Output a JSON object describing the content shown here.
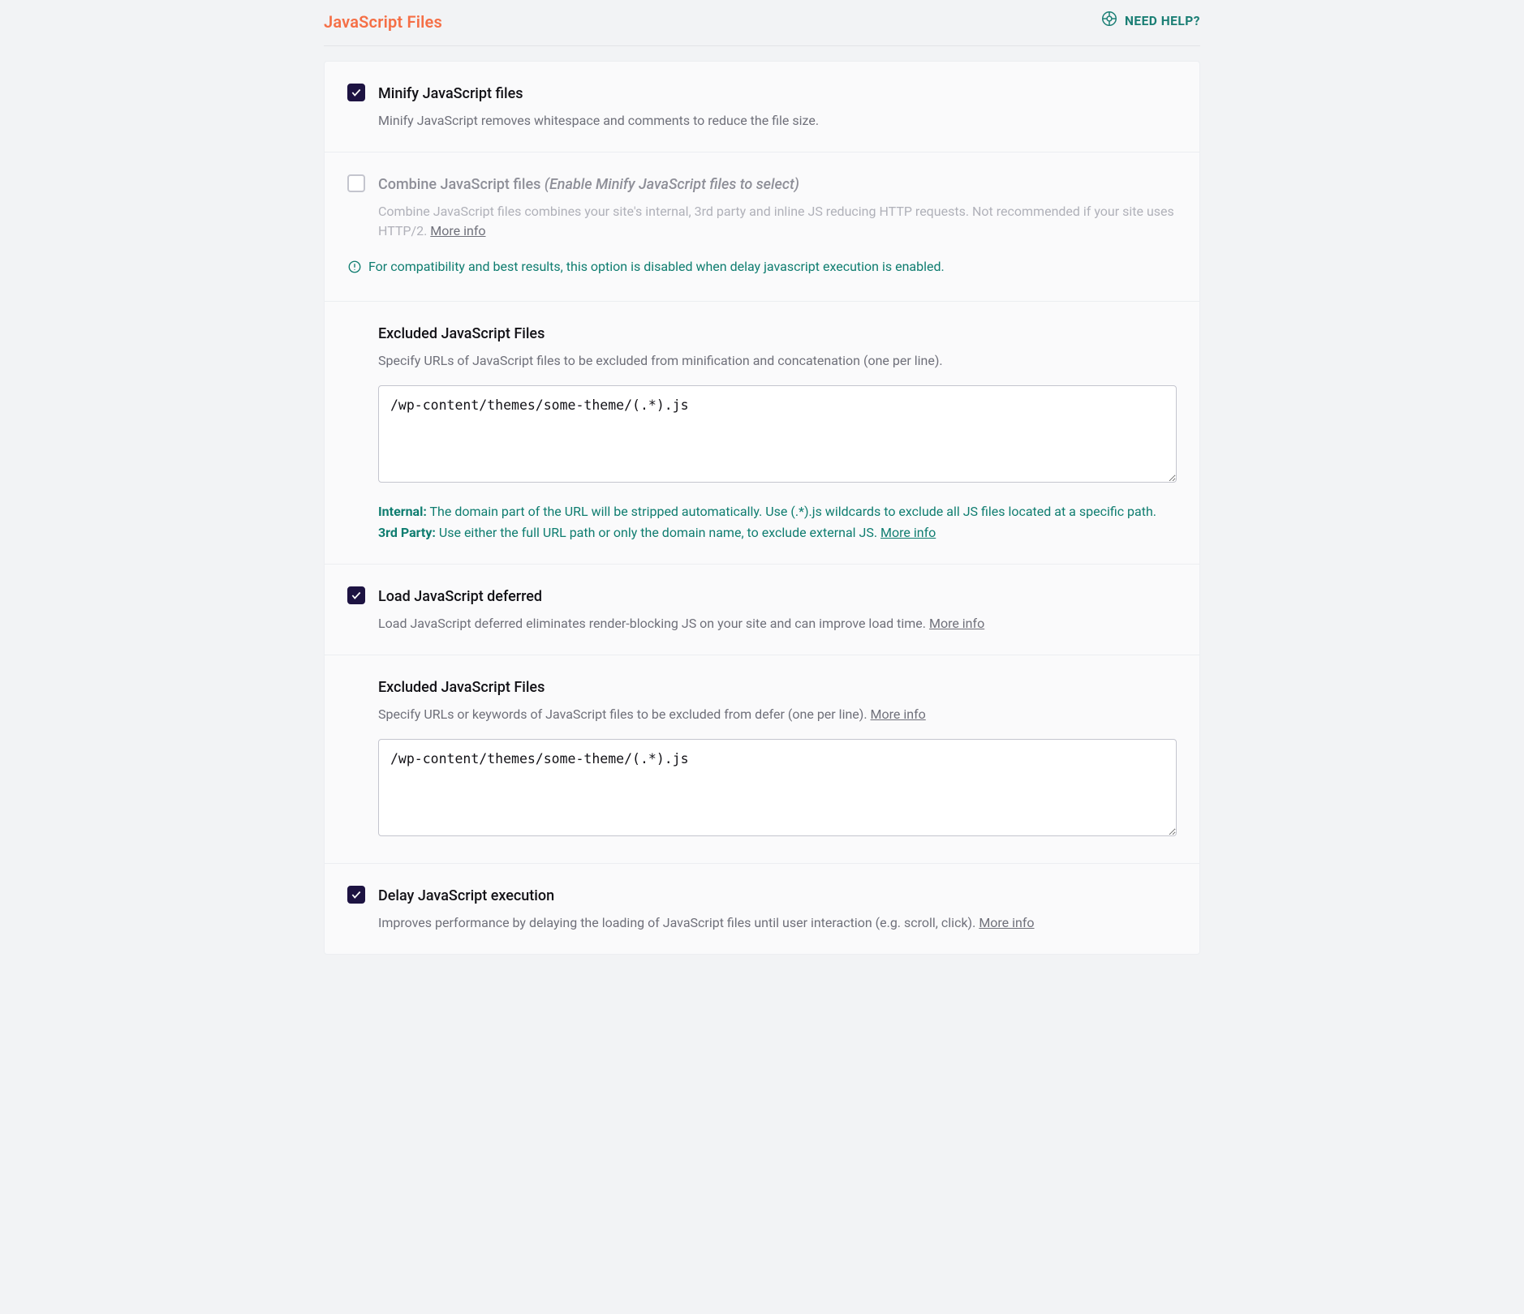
{
  "header": {
    "title": "JavaScript Files",
    "help_label": "NEED HELP?"
  },
  "options": {
    "minify": {
      "title": "Minify JavaScript files",
      "desc": "Minify JavaScript removes whitespace and comments to reduce the file size."
    },
    "combine": {
      "title": "Combine JavaScript files",
      "hint": "(Enable Minify JavaScript files to select)",
      "desc": "Combine JavaScript files combines your site's internal, 3rd party and inline JS reducing HTTP requests. Not recommended if your site uses HTTP/2. ",
      "more": "More info",
      "notice": "For compatibility and best results, this option is disabled when delay javascript execution is enabled."
    },
    "excluded1": {
      "heading": "Excluded JavaScript Files",
      "desc": "Specify URLs of JavaScript files to be excluded from minification and concatenation (one per line).",
      "value": "/wp-content/themes/some-theme/(.*).js",
      "info_internal_label": "Internal:",
      "info_internal_text": " The domain part of the URL will be stripped automatically. Use (.*).js wildcards to exclude all JS files located at a specific path.",
      "info_third_label": "3rd Party:",
      "info_third_text": " Use either the full URL path or only the domain name, to exclude external JS. ",
      "more": "More info"
    },
    "defer": {
      "title": "Load JavaScript deferred",
      "desc": "Load JavaScript deferred eliminates render-blocking JS on your site and can improve load time. ",
      "more": "More info"
    },
    "excluded2": {
      "heading": "Excluded JavaScript Files",
      "desc": "Specify URLs or keywords of JavaScript files to be excluded from defer (one per line). ",
      "more": "More info",
      "value": "/wp-content/themes/some-theme/(.*).js"
    },
    "delay": {
      "title": "Delay JavaScript execution",
      "desc": "Improves performance by delaying the loading of JavaScript files until user interaction (e.g. scroll, click). ",
      "more": "More info"
    }
  }
}
